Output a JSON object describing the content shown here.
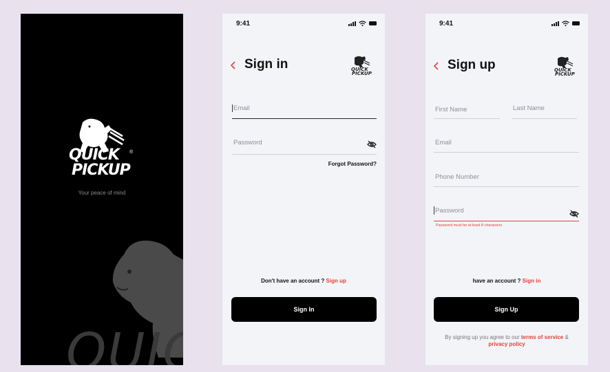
{
  "splash": {
    "brand_line1": "QUICK",
    "brand_line2": "PICKUP",
    "registered": "®",
    "tagline": "Your peace of mind",
    "background_word": "QUIC"
  },
  "signin": {
    "time": "9:41",
    "title": "Sign in",
    "email_placeholder": "Email",
    "password_placeholder": "Password",
    "forgot_password": "Forgot Password?",
    "account_prompt": "Don't have an account ?",
    "signup_link": "Sign up",
    "submit_label": "Sign In"
  },
  "signup": {
    "time": "9:41",
    "title": "Sign up",
    "first_name_placeholder": "First Name",
    "last_name_placeholder": "Last Name",
    "email_placeholder": "Email",
    "phone_placeholder": "Phone Number",
    "password_placeholder": "Password",
    "password_error": "Password must be at least 8 characters",
    "account_prompt": "have an account ?",
    "signin_link": "Sign in",
    "submit_label": "Sign Up",
    "terms_prefix": "By signing up you agree to our",
    "terms_link": "terms of service",
    "terms_amp": "&",
    "privacy_link": "privacy policy"
  },
  "colors": {
    "accent": "#e2423a",
    "background": "#e9e1ee",
    "screen": "#f3f4f8",
    "splash": "#000000"
  },
  "icons": [
    "back-chevron-icon",
    "eye-off-icon",
    "signal-icon",
    "wifi-icon",
    "battery-icon",
    "cheetah-logo-icon"
  ]
}
